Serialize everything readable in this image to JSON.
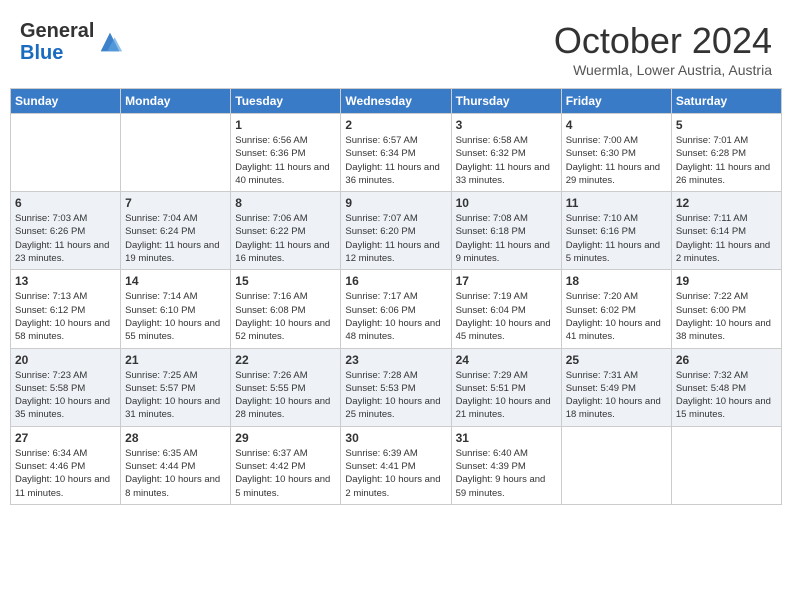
{
  "header": {
    "logo_line1": "General",
    "logo_line2": "Blue",
    "month": "October 2024",
    "location": "Wuermla, Lower Austria, Austria"
  },
  "days_of_week": [
    "Sunday",
    "Monday",
    "Tuesday",
    "Wednesday",
    "Thursday",
    "Friday",
    "Saturday"
  ],
  "weeks": [
    [
      {
        "day": "",
        "info": ""
      },
      {
        "day": "",
        "info": ""
      },
      {
        "day": "1",
        "info": "Sunrise: 6:56 AM\nSunset: 6:36 PM\nDaylight: 11 hours and 40 minutes."
      },
      {
        "day": "2",
        "info": "Sunrise: 6:57 AM\nSunset: 6:34 PM\nDaylight: 11 hours and 36 minutes."
      },
      {
        "day": "3",
        "info": "Sunrise: 6:58 AM\nSunset: 6:32 PM\nDaylight: 11 hours and 33 minutes."
      },
      {
        "day": "4",
        "info": "Sunrise: 7:00 AM\nSunset: 6:30 PM\nDaylight: 11 hours and 29 minutes."
      },
      {
        "day": "5",
        "info": "Sunrise: 7:01 AM\nSunset: 6:28 PM\nDaylight: 11 hours and 26 minutes."
      }
    ],
    [
      {
        "day": "6",
        "info": "Sunrise: 7:03 AM\nSunset: 6:26 PM\nDaylight: 11 hours and 23 minutes."
      },
      {
        "day": "7",
        "info": "Sunrise: 7:04 AM\nSunset: 6:24 PM\nDaylight: 11 hours and 19 minutes."
      },
      {
        "day": "8",
        "info": "Sunrise: 7:06 AM\nSunset: 6:22 PM\nDaylight: 11 hours and 16 minutes."
      },
      {
        "day": "9",
        "info": "Sunrise: 7:07 AM\nSunset: 6:20 PM\nDaylight: 11 hours and 12 minutes."
      },
      {
        "day": "10",
        "info": "Sunrise: 7:08 AM\nSunset: 6:18 PM\nDaylight: 11 hours and 9 minutes."
      },
      {
        "day": "11",
        "info": "Sunrise: 7:10 AM\nSunset: 6:16 PM\nDaylight: 11 hours and 5 minutes."
      },
      {
        "day": "12",
        "info": "Sunrise: 7:11 AM\nSunset: 6:14 PM\nDaylight: 11 hours and 2 minutes."
      }
    ],
    [
      {
        "day": "13",
        "info": "Sunrise: 7:13 AM\nSunset: 6:12 PM\nDaylight: 10 hours and 58 minutes."
      },
      {
        "day": "14",
        "info": "Sunrise: 7:14 AM\nSunset: 6:10 PM\nDaylight: 10 hours and 55 minutes."
      },
      {
        "day": "15",
        "info": "Sunrise: 7:16 AM\nSunset: 6:08 PM\nDaylight: 10 hours and 52 minutes."
      },
      {
        "day": "16",
        "info": "Sunrise: 7:17 AM\nSunset: 6:06 PM\nDaylight: 10 hours and 48 minutes."
      },
      {
        "day": "17",
        "info": "Sunrise: 7:19 AM\nSunset: 6:04 PM\nDaylight: 10 hours and 45 minutes."
      },
      {
        "day": "18",
        "info": "Sunrise: 7:20 AM\nSunset: 6:02 PM\nDaylight: 10 hours and 41 minutes."
      },
      {
        "day": "19",
        "info": "Sunrise: 7:22 AM\nSunset: 6:00 PM\nDaylight: 10 hours and 38 minutes."
      }
    ],
    [
      {
        "day": "20",
        "info": "Sunrise: 7:23 AM\nSunset: 5:58 PM\nDaylight: 10 hours and 35 minutes."
      },
      {
        "day": "21",
        "info": "Sunrise: 7:25 AM\nSunset: 5:57 PM\nDaylight: 10 hours and 31 minutes."
      },
      {
        "day": "22",
        "info": "Sunrise: 7:26 AM\nSunset: 5:55 PM\nDaylight: 10 hours and 28 minutes."
      },
      {
        "day": "23",
        "info": "Sunrise: 7:28 AM\nSunset: 5:53 PM\nDaylight: 10 hours and 25 minutes."
      },
      {
        "day": "24",
        "info": "Sunrise: 7:29 AM\nSunset: 5:51 PM\nDaylight: 10 hours and 21 minutes."
      },
      {
        "day": "25",
        "info": "Sunrise: 7:31 AM\nSunset: 5:49 PM\nDaylight: 10 hours and 18 minutes."
      },
      {
        "day": "26",
        "info": "Sunrise: 7:32 AM\nSunset: 5:48 PM\nDaylight: 10 hours and 15 minutes."
      }
    ],
    [
      {
        "day": "27",
        "info": "Sunrise: 6:34 AM\nSunset: 4:46 PM\nDaylight: 10 hours and 11 minutes."
      },
      {
        "day": "28",
        "info": "Sunrise: 6:35 AM\nSunset: 4:44 PM\nDaylight: 10 hours and 8 minutes."
      },
      {
        "day": "29",
        "info": "Sunrise: 6:37 AM\nSunset: 4:42 PM\nDaylight: 10 hours and 5 minutes."
      },
      {
        "day": "30",
        "info": "Sunrise: 6:39 AM\nSunset: 4:41 PM\nDaylight: 10 hours and 2 minutes."
      },
      {
        "day": "31",
        "info": "Sunrise: 6:40 AM\nSunset: 4:39 PM\nDaylight: 9 hours and 59 minutes."
      },
      {
        "day": "",
        "info": ""
      },
      {
        "day": "",
        "info": ""
      }
    ]
  ]
}
